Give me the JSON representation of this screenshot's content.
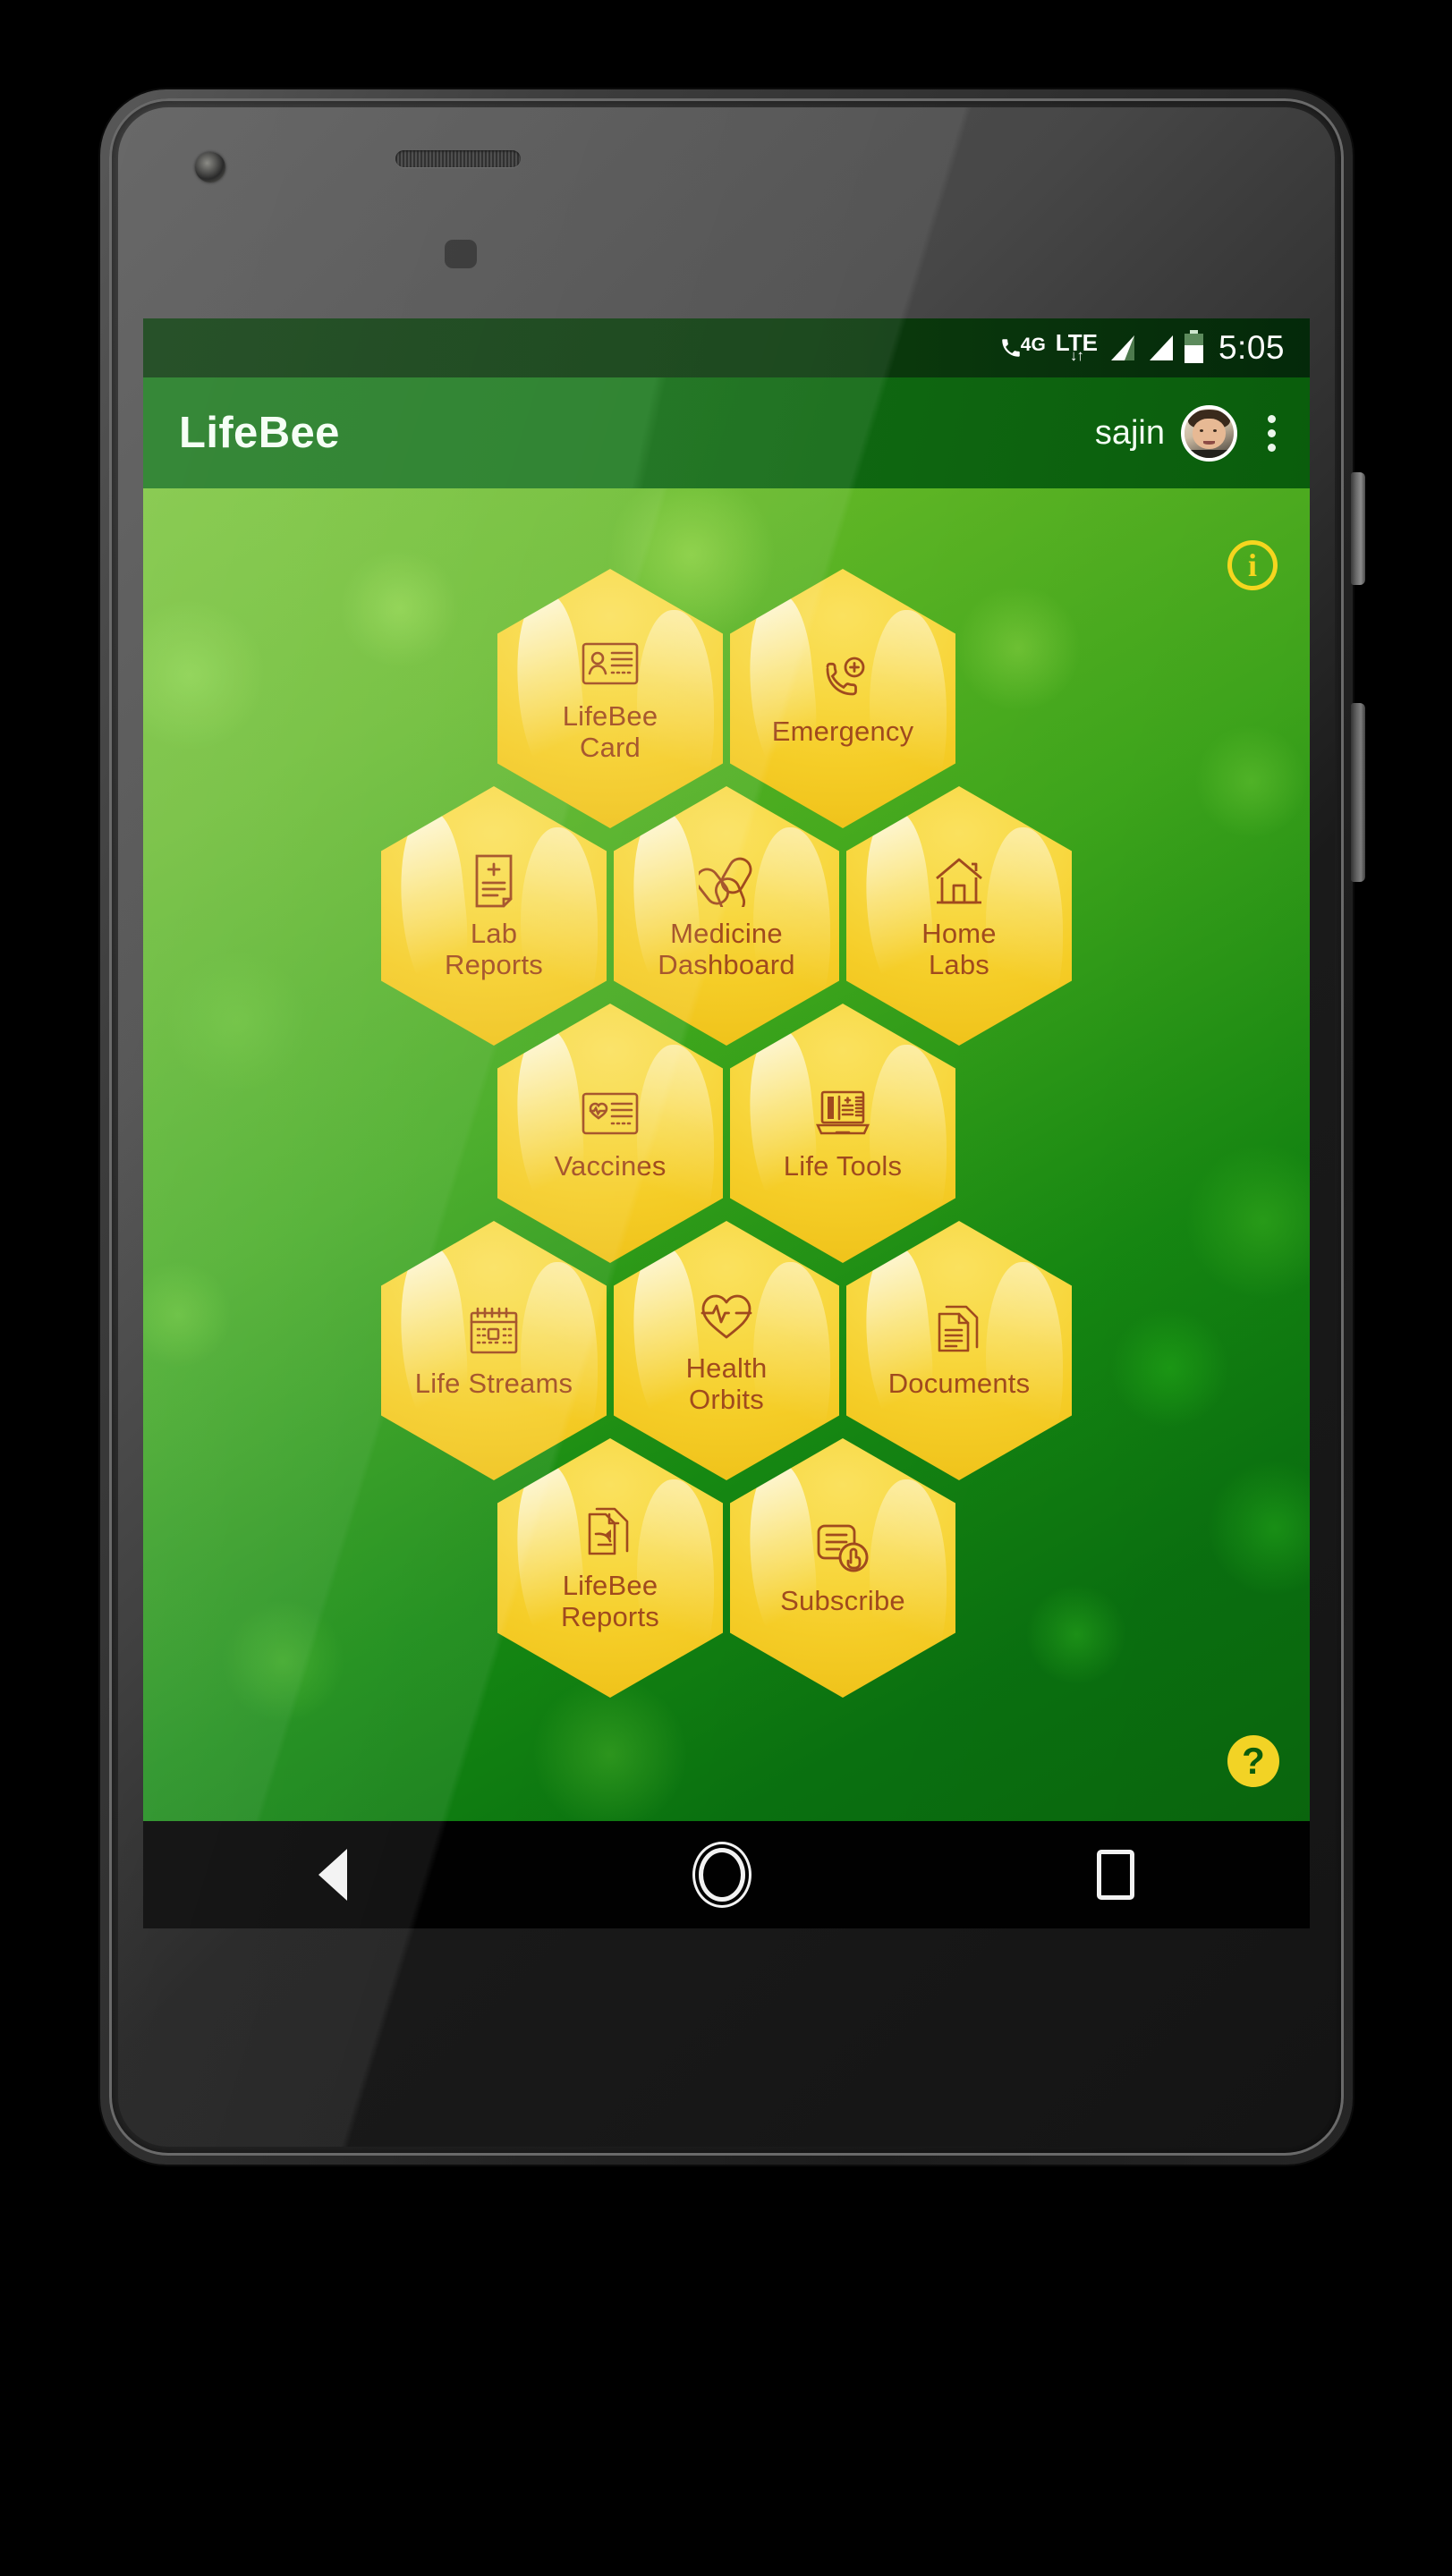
{
  "status_bar": {
    "network_label": "4G",
    "network_g": "G",
    "lte_label": "LTE",
    "data_arrows": "↓↑",
    "clock": "5:05",
    "icons": [
      "phone-4g-icon",
      "lte-icon",
      "signal-bars-icon",
      "signal-bars-icon",
      "battery-icon"
    ]
  },
  "app_bar": {
    "title": "LifeBee",
    "user_name": "sajin",
    "avatar_name": "user-avatar",
    "overflow_label": "⋮"
  },
  "content": {
    "info_label": "i",
    "help_label": "?",
    "info_color": "#f5d61f",
    "help_bg": "#f2d325",
    "help_fg": "#0a5d0c",
    "tile_color": "#f8d841",
    "tile_text_color": "#a04a1e",
    "brand_green": "#1f7a21"
  },
  "honeycomb": {
    "rows": [
      {
        "tiles": [
          {
            "id": "lifebee-card",
            "icon": "id-card-icon",
            "line1": "LifeBee",
            "line2": "Card"
          },
          {
            "id": "emergency",
            "icon": "emergency-call-icon",
            "line1": "Emergency",
            "line2": ""
          }
        ]
      },
      {
        "tiles": [
          {
            "id": "lab-reports",
            "icon": "lab-report-icon",
            "line1": "Lab",
            "line2": "Reports"
          },
          {
            "id": "medicine-dashboard",
            "icon": "pills-icon",
            "line1": "Medicine",
            "line2": "Dashboard"
          },
          {
            "id": "home-labs",
            "icon": "house-icon",
            "line1": "Home",
            "line2": "Labs"
          }
        ]
      },
      {
        "tiles": [
          {
            "id": "vaccines",
            "icon": "heart-card-icon",
            "line1": "Vaccines",
            "line2": ""
          },
          {
            "id": "life-tools",
            "icon": "laptop-chart-icon",
            "line1": "Life Tools",
            "line2": ""
          }
        ]
      },
      {
        "tiles": [
          {
            "id": "life-streams",
            "icon": "calendar-icon",
            "line1": "Life Streams",
            "line2": ""
          },
          {
            "id": "health-orbits",
            "icon": "heart-pulse-icon",
            "line1": "Health",
            "line2": "Orbits"
          },
          {
            "id": "documents",
            "icon": "documents-icon",
            "line1": "Documents",
            "line2": ""
          }
        ]
      },
      {
        "tiles": [
          {
            "id": "lifebee-reports",
            "icon": "share-document-icon",
            "line1": "LifeBee",
            "line2": "Reports"
          },
          {
            "id": "subscribe",
            "icon": "subscribe-tap-icon",
            "line1": "Subscribe",
            "line2": ""
          }
        ]
      }
    ]
  },
  "nav_bar": {
    "back": "back-icon",
    "home": "home-icon",
    "recents": "recents-icon"
  }
}
